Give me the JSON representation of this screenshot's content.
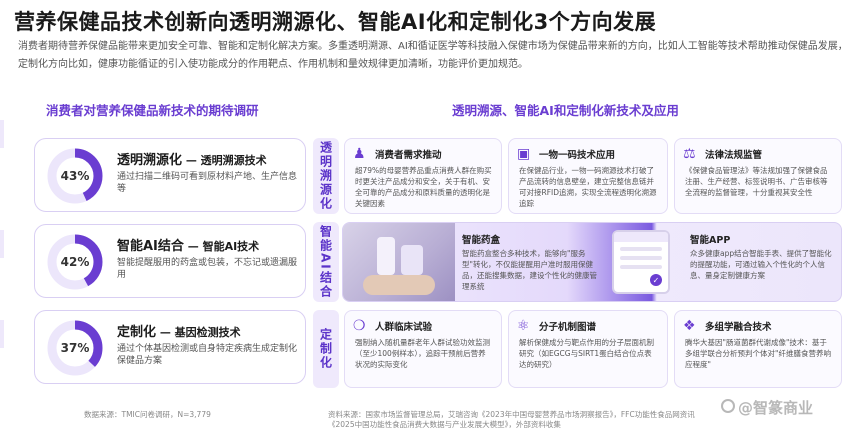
{
  "title": "营养保健品技术创新向透明溯源化、智能AI化和定制化3个方向发展",
  "intro": "消费者期待营养保健品能带来更加安全可靠、智能和定制化解决方案。多重透明溯源、AI和循证医学等科技融入保健市场为保健品带来新的方向，比如人工智能等技术帮助推动保健品发展，定制化方向比如，健康功能循证的引入使功能成分的作用靶点、作用机制和量效规律更加清晰，功能评价更加规范。",
  "left_heading": "消费者对营养保健品新技术的期待调研",
  "right_heading": "透明溯源、智能AI和定制化新技术及应用",
  "stats": [
    {
      "pct": "43%",
      "value": 0.43,
      "title": "透明溯源化",
      "subtitle": " — 透明溯源技术",
      "desc": "通过扫描二维码可看到原材料产地、生产信息等"
    },
    {
      "pct": "42%",
      "value": 0.42,
      "title": "智能AI结合",
      "subtitle": " — 智能AI技术",
      "desc": "智能提醒服用的药盒或包装，不忘记或遗漏服用"
    },
    {
      "pct": "37%",
      "value": 0.37,
      "title": "定制化",
      "subtitle": " — 基因检测技术",
      "desc": "通过个体基因检测或自身特定疾病生成定制化保健品方案"
    }
  ],
  "row_labels": [
    "透明溯源化",
    "智能AI结合",
    "定制化"
  ],
  "row1": [
    {
      "icon": "person-group-icon",
      "title": "消费者需求推动",
      "desc": "超79%的母婴营养品重点消费人群在购买时更关注产品成分和安全，关于有机、安全可靠的产品成分和原料质量的透明化是关键因素"
    },
    {
      "icon": "monitor-icon",
      "title": "一物一码技术应用",
      "desc": "在保健品行业，一物一码溯源技术打破了产品流转的信息壁垒，建立完整信息链并可对接RFID追溯，实现全流程透明化溯源追踪"
    },
    {
      "icon": "scale-icon",
      "title": "法律法规监管",
      "desc": "《保健食品管理法》等法规加强了保健食品注册、生产经营、标签说明书、广告审核等全流程的监督管理，十分重视其安全性"
    }
  ],
  "row2": [
    {
      "title": "智能药盒",
      "desc": "智能药盒整合多种技术，能够向\"服务型\"转化，不仅能提醒用户准时服用保健品，还能搜集数据，建设个性化的健康管理系统"
    },
    {
      "title": "智能APP",
      "desc": "众多健康app结合智能手表、提供了智能化的提醒功能，可通过输入个性化的个人信息、量身定制健康方案"
    }
  ],
  "row3": [
    {
      "icon": "dna-icon",
      "title": "人群临床试验",
      "desc": "强制纳入随机量群老年人群试验功效监测（至少100例样本），追踪干预前后营养状况的实际变化"
    },
    {
      "icon": "molecule-icon",
      "title": "分子机制图谱",
      "desc": "解析保健成分与靶点作用的分子层面机制研究（如EGCG与SIRT1蛋白结合位点表达的研究）"
    },
    {
      "icon": "cube-icon",
      "title": "多组学融合技术",
      "desc": "腾华大基因\"肠道菌群代谢成像\"技术：基于多组学联合分析预判个体对\"纤维膳食营养响应程度\""
    }
  ],
  "footer_left": "数据来源：TMIC问卷调研，N=3,779",
  "footer_right": "资料来源：国家市场监督管理总局，艾瑞咨询《2023年中国母婴营养品市场洞察报告》，FFC功能性食品网资讯《2025中国功能性食品消费大数据与产业发展大模型》，外部资料收集",
  "watermark": "@智篆商业",
  "colors": {
    "accent": "#6a3dd1",
    "donut_track": "#ece6fb"
  }
}
